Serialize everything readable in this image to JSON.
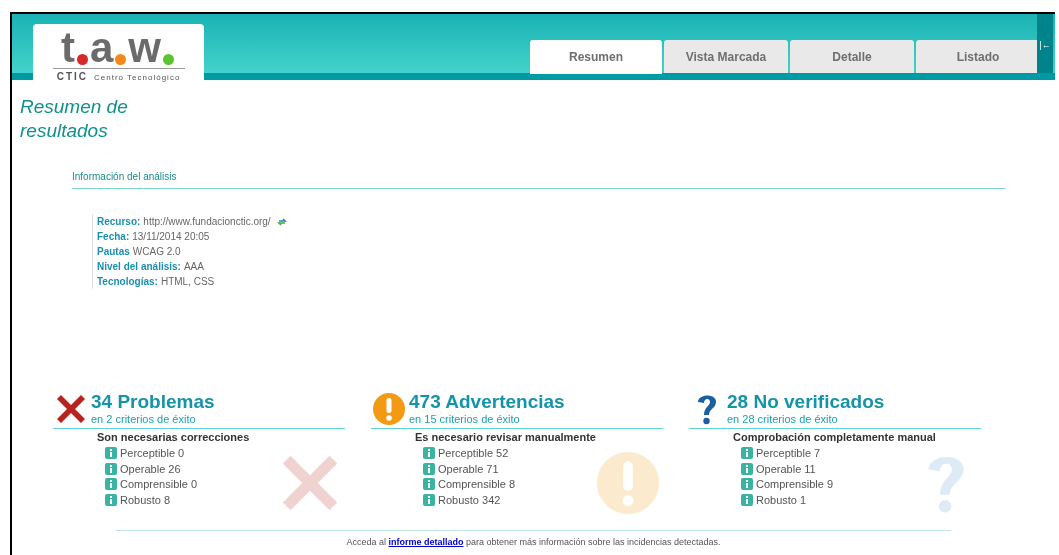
{
  "logo": {
    "letters": [
      {
        "letter": "t",
        "color": "#d42a2a"
      },
      {
        "letter": "a",
        "color": "#f28a1a"
      },
      {
        "letter": "w",
        "color": "#5cc430"
      }
    ],
    "org": "CTIC",
    "org_name": "Centro Tecnológico"
  },
  "collapse_icon": "|←",
  "tabs": [
    {
      "label": "Resumen",
      "selected": true
    },
    {
      "label": "Vista Marcada",
      "selected": false
    },
    {
      "label": "Detalle",
      "selected": false
    },
    {
      "label": "Listado",
      "selected": false
    }
  ],
  "page_title": "Resumen de resultados",
  "analysis": {
    "heading": "Información del análisis",
    "fields": [
      {
        "label": "Recurso:",
        "value": "http://www.fundacionctic.org/",
        "refresh": true
      },
      {
        "label": "Fecha:",
        "value": "13/11/2014 20:05",
        "refresh": false
      },
      {
        "label": "Pautas",
        "value": "WCAG 2.0",
        "refresh": false
      },
      {
        "label": "Nivel del análisis:",
        "value": "AAA",
        "refresh": false
      },
      {
        "label": "Tecnologías:",
        "value": "HTML, CSS",
        "refresh": false
      }
    ]
  },
  "summaries": [
    {
      "kind": "error",
      "title": "34 Problemas",
      "subtitle": "en 2 criterios de éxito",
      "note": "Son necesarias correcciones",
      "items": [
        "Perceptible 0",
        "Operable 26",
        "Comprensible 0",
        "Robusto 8"
      ]
    },
    {
      "kind": "warning",
      "title": "473 Advertencias",
      "subtitle": "en 15 criterios de éxito",
      "note": "Es necesario revisar manualmente",
      "items": [
        "Perceptible 52",
        "Operable 71",
        "Comprensible 8",
        "Robusto 342"
      ]
    },
    {
      "kind": "unverified",
      "title": "28 No verificados",
      "subtitle": "en 28 criterios de éxito",
      "note": "Comprobación completamente manual",
      "items": [
        "Perceptible 7",
        "Operable 11",
        "Comprensible 9",
        "Robusto 1"
      ]
    }
  ],
  "footer": {
    "before": "Acceda al",
    "link": "informe detallado",
    "after": "para obtener más información sobre las incidencias detectadas."
  }
}
